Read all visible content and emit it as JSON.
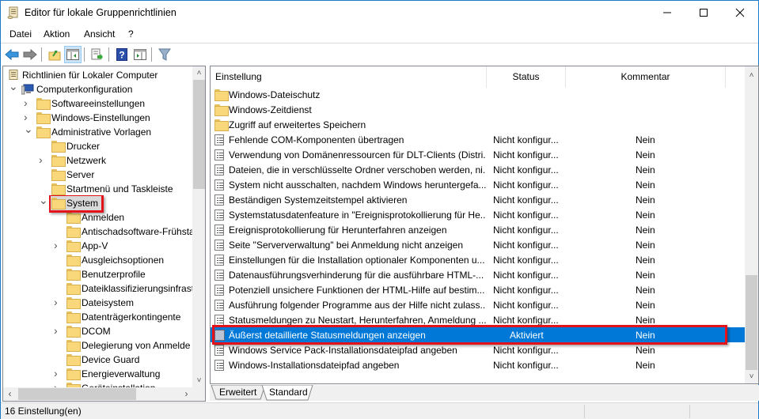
{
  "window": {
    "title": "Editor für lokale Gruppenrichtlinien",
    "controls": {
      "minimize": "—",
      "maximize": "☐",
      "close": "✕"
    }
  },
  "menu": [
    "Datei",
    "Aktion",
    "Ansicht",
    "?"
  ],
  "toolbar": {
    "buttons": [
      {
        "name": "back",
        "icon": "arrow-left-icon"
      },
      {
        "name": "forward",
        "icon": "arrow-right-icon"
      },
      {
        "name": "up-one-level",
        "icon": "folder-up-icon"
      },
      {
        "name": "show-hide-console-tree",
        "icon": "console-tree-icon",
        "active": true
      },
      {
        "name": "export-list",
        "icon": "export-list-icon"
      },
      {
        "name": "help",
        "icon": "help-icon",
        "glyph": "?"
      },
      {
        "name": "show-hide-action-pane",
        "icon": "action-pane-icon"
      },
      {
        "name": "filter",
        "icon": "filter-icon"
      }
    ]
  },
  "tree": {
    "items": [
      {
        "label": "Richtlinien für Lokaler Computer",
        "level": 0,
        "expander": "",
        "icon": "policy-scroll-icon"
      },
      {
        "label": "Computerkonfiguration",
        "level": 0,
        "expander": "expanded",
        "icon": "computer-icon"
      },
      {
        "label": "Softwareeinstellungen",
        "level": 1,
        "expander": "collapsed",
        "icon": "folder-icon"
      },
      {
        "label": "Windows-Einstellungen",
        "level": 1,
        "expander": "collapsed",
        "icon": "folder-icon"
      },
      {
        "label": "Administrative Vorlagen",
        "level": 1,
        "expander": "expanded",
        "icon": "folder-icon"
      },
      {
        "label": "Drucker",
        "level": 2,
        "expander": "",
        "icon": "folder-icon"
      },
      {
        "label": "Netzwerk",
        "level": 2,
        "expander": "collapsed",
        "icon": "folder-icon"
      },
      {
        "label": "Server",
        "level": 2,
        "expander": "",
        "icon": "folder-icon"
      },
      {
        "label": "Startmenü und Taskleiste",
        "level": 2,
        "expander": "",
        "icon": "folder-icon"
      },
      {
        "label": "System",
        "level": 2,
        "expander": "expanded",
        "icon": "folder-icon",
        "selected": true
      },
      {
        "label": "Anmelden",
        "level": 3,
        "expander": "",
        "icon": "folder-icon"
      },
      {
        "label": "Antischadsoftware-Frühsta",
        "level": 3,
        "expander": "",
        "icon": "folder-icon"
      },
      {
        "label": "App-V",
        "level": 3,
        "expander": "collapsed",
        "icon": "folder-icon"
      },
      {
        "label": "Ausgleichsoptionen",
        "level": 3,
        "expander": "",
        "icon": "folder-icon"
      },
      {
        "label": "Benutzerprofile",
        "level": 3,
        "expander": "",
        "icon": "folder-icon"
      },
      {
        "label": "Dateiklassifizierungsinfrast",
        "level": 3,
        "expander": "",
        "icon": "folder-icon"
      },
      {
        "label": "Dateisystem",
        "level": 3,
        "expander": "collapsed",
        "icon": "folder-icon"
      },
      {
        "label": "Datenträgerkontingente",
        "level": 3,
        "expander": "",
        "icon": "folder-icon"
      },
      {
        "label": "DCOM",
        "level": 3,
        "expander": "collapsed",
        "icon": "folder-icon"
      },
      {
        "label": "Delegierung von Anmelde",
        "level": 3,
        "expander": "",
        "icon": "folder-icon"
      },
      {
        "label": "Device Guard",
        "level": 3,
        "expander": "",
        "icon": "folder-icon"
      },
      {
        "label": "Energieverwaltung",
        "level": 3,
        "expander": "collapsed",
        "icon": "folder-icon"
      },
      {
        "label": "Geräteinstallation",
        "level": 3,
        "expander": "collapsed",
        "icon": "folder-icon"
      }
    ]
  },
  "list": {
    "columns": [
      "Einstellung",
      "Status",
      "Kommentar"
    ],
    "rows": [
      {
        "name": "Windows-Dateischutz",
        "status": "",
        "comment": "",
        "type": "folder"
      },
      {
        "name": "Windows-Zeitdienst",
        "status": "",
        "comment": "",
        "type": "folder"
      },
      {
        "name": "Zugriff auf erweitertes Speichern",
        "status": "",
        "comment": "",
        "type": "folder"
      },
      {
        "name": "Fehlende COM-Komponenten übertragen",
        "status": "Nicht konfigur...",
        "comment": "Nein",
        "type": "policy"
      },
      {
        "name": "Verwendung von Domänenressourcen für DLT-Clients (Distri...",
        "status": "Nicht konfigur...",
        "comment": "Nein",
        "type": "policy"
      },
      {
        "name": "Dateien, die in verschlüsselte Ordner verschoben werden, ni...",
        "status": "Nicht konfigur...",
        "comment": "Nein",
        "type": "policy"
      },
      {
        "name": "System nicht ausschalten, nachdem Windows heruntergefa...",
        "status": "Nicht konfigur...",
        "comment": "Nein",
        "type": "policy"
      },
      {
        "name": "Beständigen Systemzeitstempel aktivieren",
        "status": "Nicht konfigur...",
        "comment": "Nein",
        "type": "policy"
      },
      {
        "name": "Systemstatusdatenfeature in \"Ereignisprotokollierung für He...",
        "status": "Nicht konfigur...",
        "comment": "Nein",
        "type": "policy"
      },
      {
        "name": "Ereignisprotokollierung für Herunterfahren anzeigen",
        "status": "Nicht konfigur...",
        "comment": "Nein",
        "type": "policy"
      },
      {
        "name": "Seite \"Serververwaltung\" bei Anmeldung nicht anzeigen",
        "status": "Nicht konfigur...",
        "comment": "Nein",
        "type": "policy"
      },
      {
        "name": "Einstellungen für die Installation optionaler Komponenten u...",
        "status": "Nicht konfigur...",
        "comment": "Nein",
        "type": "policy"
      },
      {
        "name": "Datenausführungsverhinderung für die ausführbare HTML-...",
        "status": "Nicht konfigur...",
        "comment": "Nein",
        "type": "policy"
      },
      {
        "name": "Potenziell unsichere Funktionen der HTML-Hilfe auf bestim...",
        "status": "Nicht konfigur...",
        "comment": "Nein",
        "type": "policy"
      },
      {
        "name": "Ausführung folgender Programme aus der Hilfe nicht zulass...",
        "status": "Nicht konfigur...",
        "comment": "Nein",
        "type": "policy"
      },
      {
        "name": "Statusmeldungen zu Neustart, Herunterfahren, Anmeldung ...",
        "status": "Nicht konfigur...",
        "comment": "Nein",
        "type": "policy"
      },
      {
        "name": "Äußerst detaillierte Statusmeldungen anzeigen",
        "status": "Aktiviert",
        "comment": "Nein",
        "type": "policy-enabled",
        "selected": true
      },
      {
        "name": "Windows Service Pack-Installationsdateipfad angeben",
        "status": "Nicht konfigur...",
        "comment": "Nein",
        "type": "policy"
      },
      {
        "name": "Windows-Installationsdateipfad angeben",
        "status": "Nicht konfigur...",
        "comment": "Nein",
        "type": "policy"
      }
    ]
  },
  "tabs": [
    {
      "label": "Erweitert",
      "active": false
    },
    {
      "label": "Standard",
      "active": true
    }
  ],
  "statusbar": {
    "text": "16 Einstellung(en)"
  },
  "colors": {
    "selection": "#0078d7",
    "highlight_box": "#e4121b",
    "window_border": "#1e79c6"
  }
}
